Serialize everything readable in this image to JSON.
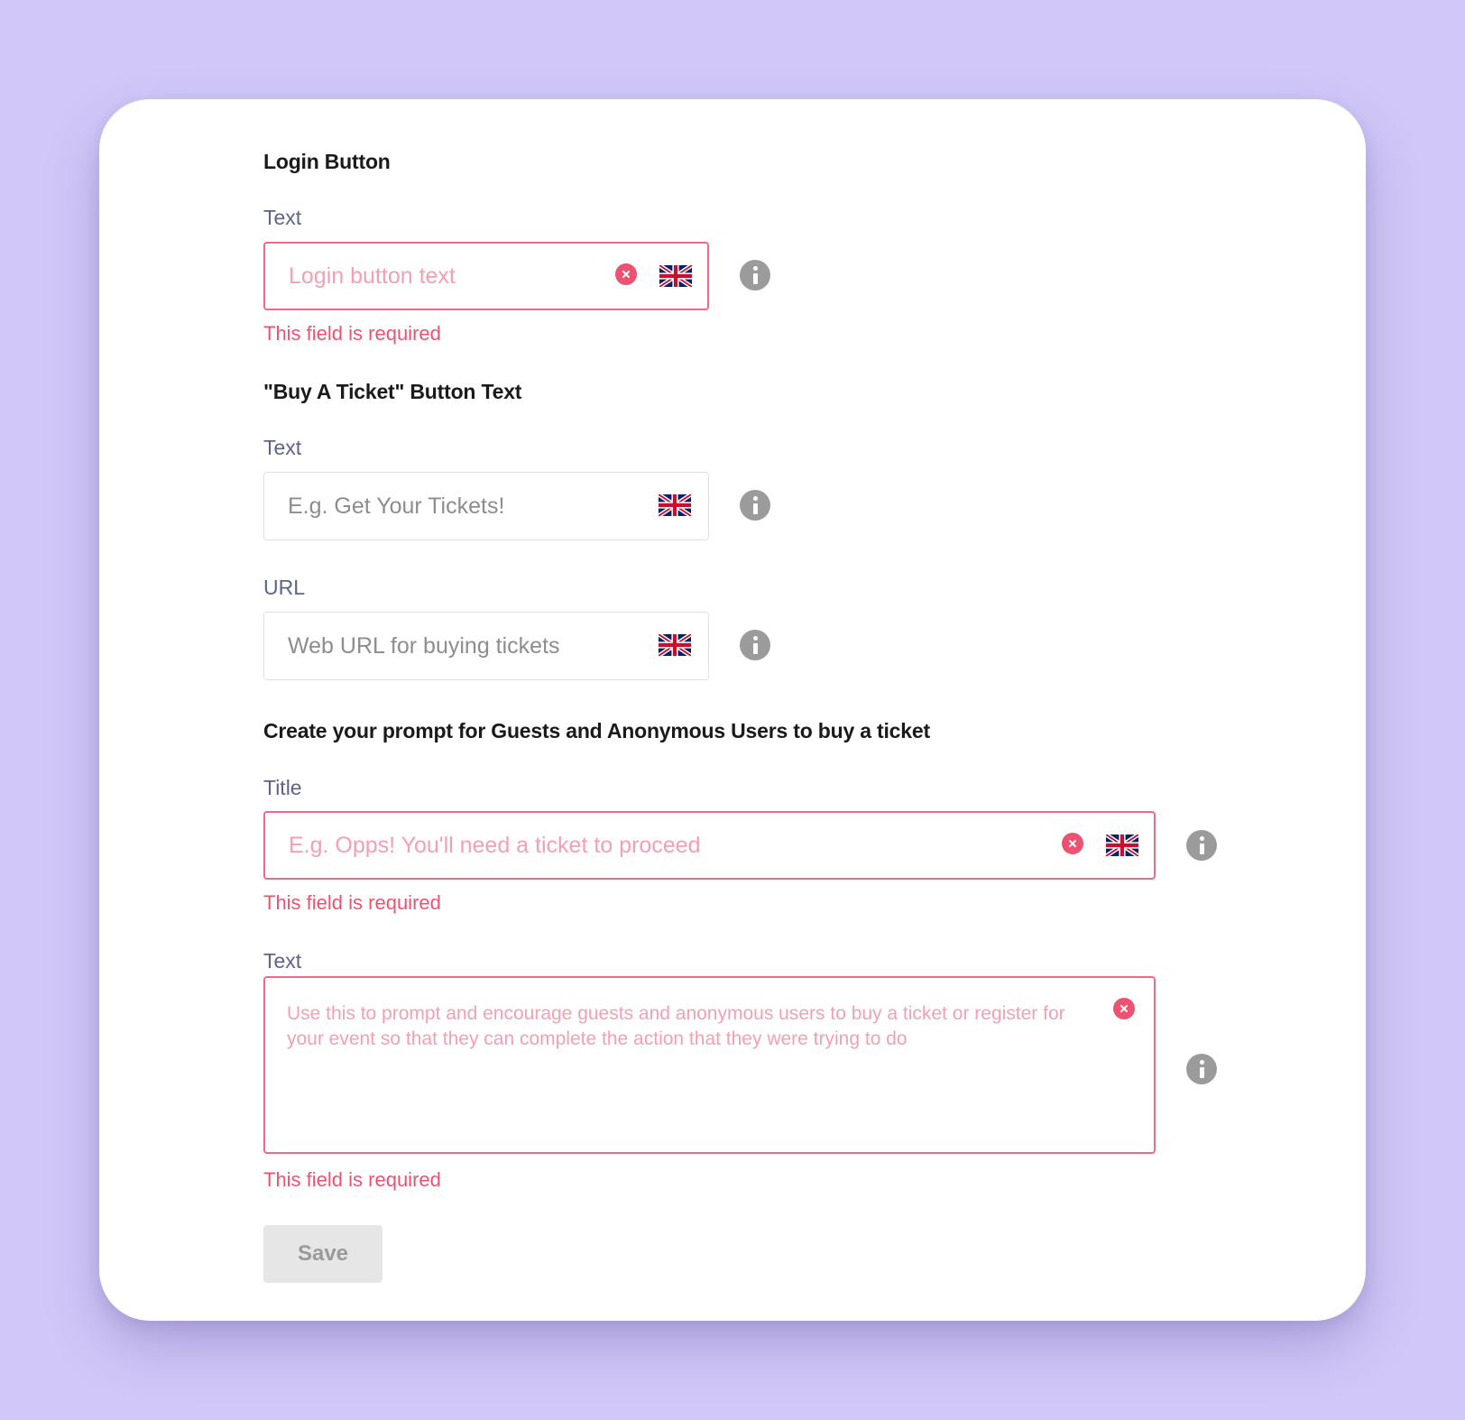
{
  "login_button": {
    "heading": "Login Button",
    "text_label": "Text",
    "text_placeholder": "Login button text",
    "error": "This field is required"
  },
  "buy_ticket": {
    "heading": "\"Buy A Ticket\" Button Text",
    "text_label": "Text",
    "text_placeholder": "E.g. Get Your Tickets!",
    "url_label": "URL",
    "url_placeholder": "Web URL for buying tickets"
  },
  "prompt": {
    "heading": "Create your prompt for Guests and Anonymous Users to buy a ticket",
    "title_label": "Title",
    "title_placeholder": "E.g. Opps! You'll need a ticket to proceed",
    "title_error": "This field is required",
    "text_label": "Text",
    "text_placeholder": "Use this to prompt and encourage guests and anonymous users to buy a ticket or register for your event so that they can complete the action that they were trying to do",
    "text_error": "This field is required"
  },
  "save_label": "Save",
  "icons": {
    "flag": "uk-flag-icon",
    "clear": "clear-circle-icon",
    "info": "info-icon"
  },
  "colors": {
    "background": "#d1c8f8",
    "error": "#ef5270",
    "label": "#5e6488",
    "info": "#9b9b9b"
  }
}
